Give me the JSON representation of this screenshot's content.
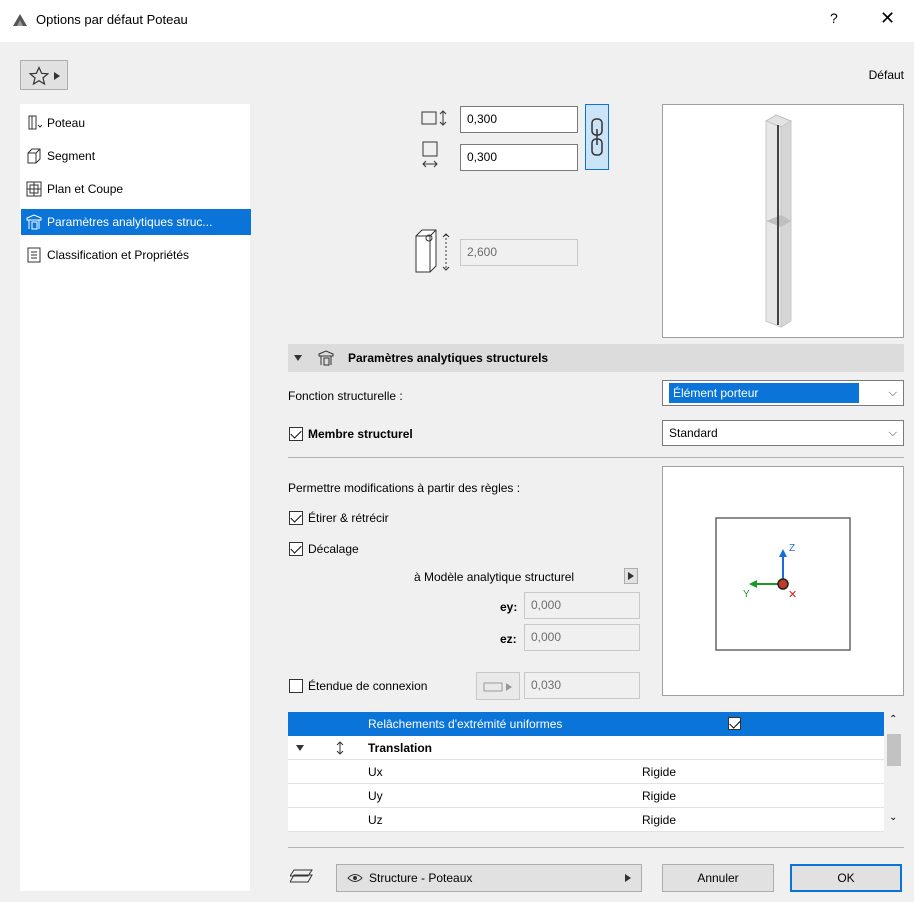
{
  "window": {
    "title": "Options par défaut Poteau",
    "help": "?",
    "close": "✕"
  },
  "toolbar": {
    "preset_label": "Défaut"
  },
  "sidebar": {
    "items": [
      {
        "label": "Poteau"
      },
      {
        "label": "Segment"
      },
      {
        "label": "Plan et Coupe"
      },
      {
        "label": "Paramètres analytiques struc..."
      },
      {
        "label": "Classification et Propriétés"
      }
    ]
  },
  "geometry": {
    "width": "0,300",
    "depth": "0,300",
    "height": "2,600"
  },
  "section": {
    "title": "Paramètres analytiques structurels",
    "fonction_label": "Fonction structurelle :",
    "fonction_value": "Élément porteur",
    "membre_label": "Membre structurel",
    "membre_value": "Standard",
    "membre_checked": true,
    "permettre_label": "Permettre modifications à partir des règles :",
    "etirer_label": "Étirer & rétrécir",
    "etirer_checked": true,
    "decalage_label": "Décalage",
    "decalage_checked": true,
    "modele_label": "à Modèle analytique structurel",
    "ey_label": "ey:",
    "ey_value": "0,000",
    "ez_label": "ez:",
    "ez_value": "0,000",
    "etendue_label": "Étendue de connexion",
    "etendue_checked": false,
    "etendue_value": "0,030",
    "axis_z": "Z",
    "axis_y": "Y"
  },
  "release_table": {
    "header": "Relâchements d'extrémité uniformes",
    "header_checked": true,
    "group": "Translation",
    "rows": [
      {
        "name": "Ux",
        "value": "Rigide"
      },
      {
        "name": "Uy",
        "value": "Rigide"
      },
      {
        "name": "Uz",
        "value": "Rigide"
      }
    ]
  },
  "footer": {
    "layer": "Structure - Poteaux",
    "cancel": "Annuler",
    "ok": "OK"
  },
  "colors": {
    "accent": "#0a74d8",
    "axis_z": "#1a6fd6",
    "axis_y": "#1a9a2a",
    "axis_x": "#d42020"
  }
}
